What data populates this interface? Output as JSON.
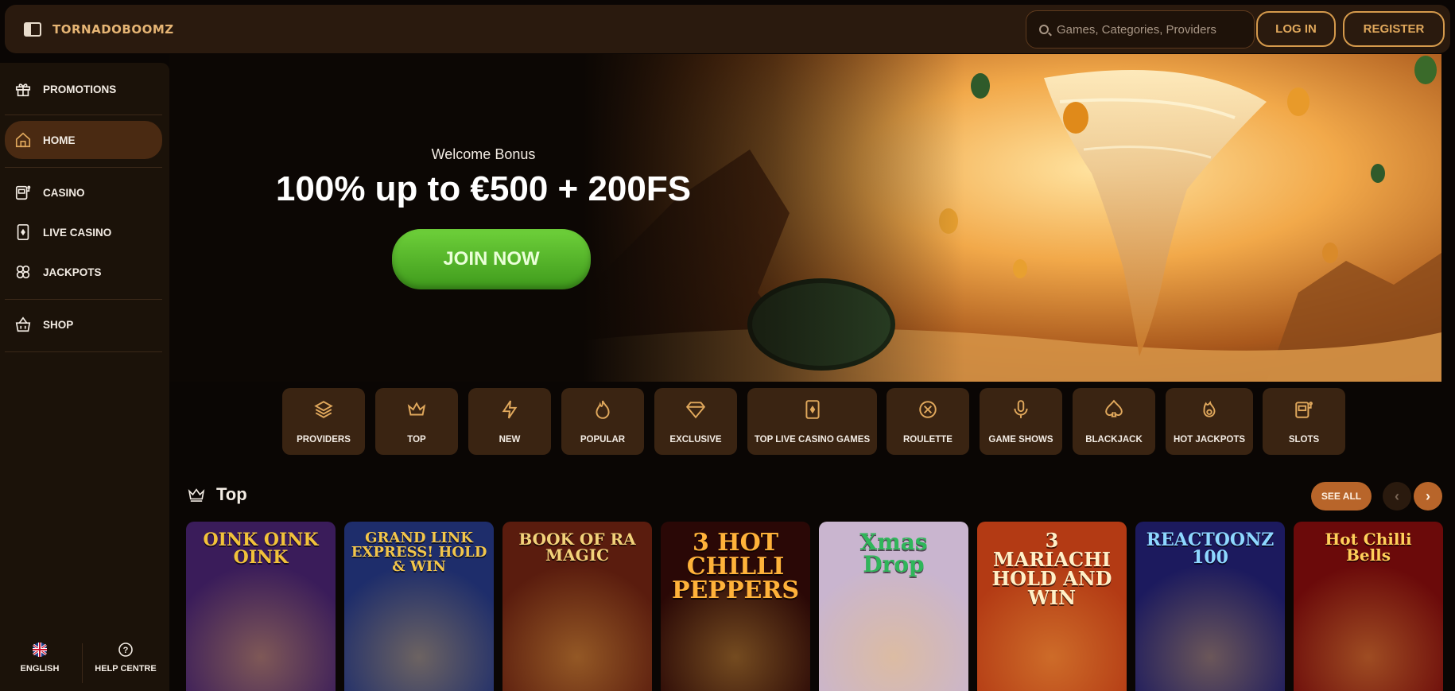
{
  "header": {
    "logo": "TORNADOBOOMZ",
    "search_placeholder": "Games, Categories, Providers",
    "login_label": "LOG IN",
    "register_label": "REGISTER"
  },
  "sidebar": {
    "items": [
      {
        "label": "PROMOTIONS",
        "icon": "gift-icon"
      },
      {
        "label": "HOME",
        "icon": "home-icon",
        "active": true
      },
      {
        "label": "CASINO",
        "icon": "slot-machine-icon"
      },
      {
        "label": "LIVE CASINO",
        "icon": "card-icon"
      },
      {
        "label": "JACKPOTS",
        "icon": "clover-icon"
      },
      {
        "label": "SHOP",
        "icon": "basket-icon"
      }
    ],
    "footer": {
      "language_label": "ENGLISH",
      "help_label": "HELP CENTRE"
    }
  },
  "hero": {
    "welcome": "Welcome Bonus",
    "headline": "100% up to €500 + 200FS",
    "cta_label": "JOIN NOW"
  },
  "categories": [
    {
      "label": "PROVIDERS",
      "icon": "layers-icon"
    },
    {
      "label": "TOP",
      "icon": "crown-icon"
    },
    {
      "label": "NEW",
      "icon": "bolt-icon"
    },
    {
      "label": "POPULAR",
      "icon": "flame-icon"
    },
    {
      "label": "EXCLUSIVE",
      "icon": "diamond-icon"
    },
    {
      "label": "TOP LIVE CASINO GAMES",
      "icon": "card-icon"
    },
    {
      "label": "ROULETTE",
      "icon": "roulette-icon"
    },
    {
      "label": "GAME SHOWS",
      "icon": "microphone-icon"
    },
    {
      "label": "BLACKJACK",
      "icon": "spade-icon"
    },
    {
      "label": "HOT JACKPOTS",
      "icon": "hot-jackpot-icon"
    },
    {
      "label": "SLOTS",
      "icon": "slot-machine-icon"
    }
  ],
  "section": {
    "title": "Top",
    "see_all_label": "SEE ALL"
  },
  "games": [
    {
      "title": "OINK OINK OINK",
      "bg": "#3a1c5a",
      "color": "#f2c23a"
    },
    {
      "title": "GRAND LINK EXPRESS! HOLD & WIN",
      "bg": "#1e2d6b",
      "color": "#f3c64a"
    },
    {
      "title": "BOOK OF RA MAGIC",
      "bg": "#5a1c0e",
      "color": "#f2d27a"
    },
    {
      "title": "3 HOT CHILLI PEPPERS",
      "bg": "#2a0806",
      "color": "#ffb23a"
    },
    {
      "title": "Xmas Drop",
      "bg": "#c9b5cf",
      "color": "#2fb65a"
    },
    {
      "title": "3 MARIACHI HOLD AND WIN",
      "bg": "#b33a14",
      "color": "#fff0c8"
    },
    {
      "title": "REACTOONZ 100",
      "bg": "#1c1a5e",
      "color": "#8ed8ff"
    },
    {
      "title": "Hot Chilli Bells",
      "bg": "#6b0a0a",
      "color": "#ffd05a"
    }
  ]
}
